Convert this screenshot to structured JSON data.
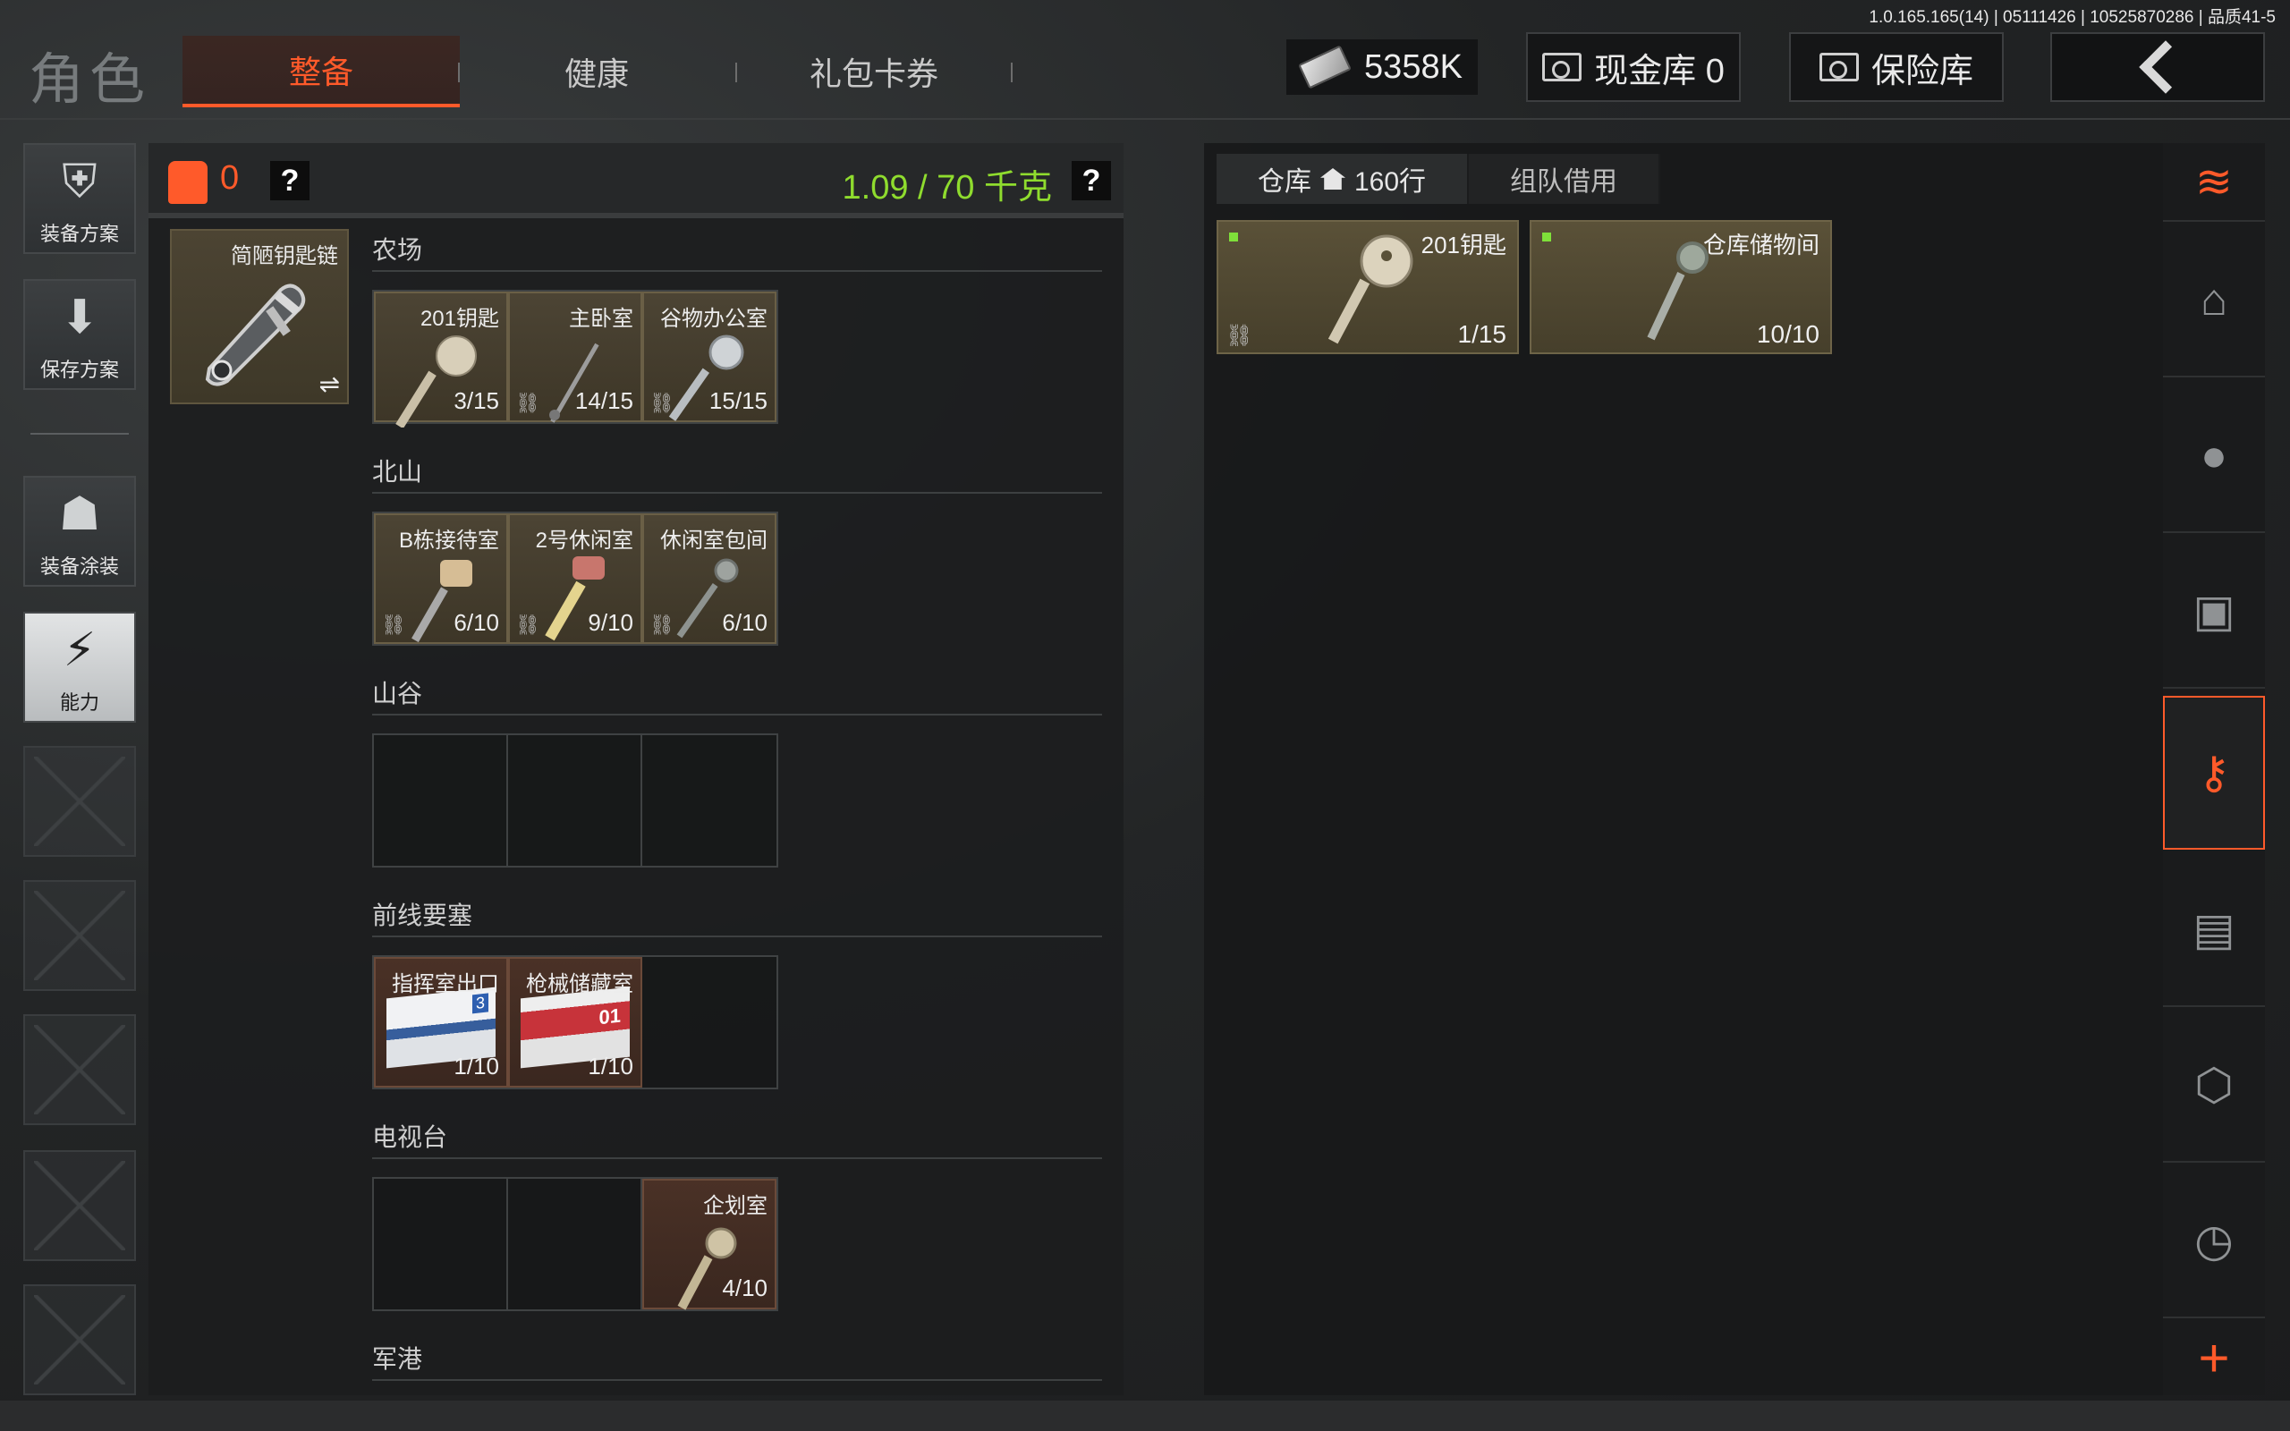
{
  "version_info": "1.0.165.165(14) | 05111426 | 10525870286 | 品质41-5",
  "header": {
    "title": "角色",
    "tabs": [
      {
        "label": "整备",
        "active": true
      },
      {
        "label": "健康",
        "active": false
      },
      {
        "label": "礼包卡券",
        "active": false
      }
    ],
    "currency": "5358K",
    "cash_vault_label": "现金库 0",
    "safe_label": "保险库",
    "back_icon": "chevron-left-icon"
  },
  "sidebar": {
    "items": [
      {
        "label": "装备方案",
        "icon": "armor-icon"
      },
      {
        "label": "保存方案",
        "icon": "download-icon"
      },
      {
        "label": "装备涂装",
        "icon": "helmet-icon"
      },
      {
        "label": "能力",
        "icon": "lightning-icon",
        "active": true
      }
    ],
    "empty_slots": 5
  },
  "keychain": {
    "vest_count": "0",
    "help_label": "?",
    "weight": "1.09 / 70 千克",
    "item_name": "简陋钥匙链",
    "swap_icon": "⇌",
    "sections": [
      {
        "title": "农场",
        "slots": [
          {
            "name": "201钥匙",
            "count": "3/15",
            "type": "key"
          },
          {
            "name": "主卧室",
            "count": "14/15",
            "type": "key"
          },
          {
            "name": "谷物办公室",
            "count": "15/15",
            "type": "key"
          }
        ]
      },
      {
        "title": "北山",
        "slots": [
          {
            "name": "B栋接待室",
            "count": "6/10",
            "type": "key"
          },
          {
            "name": "2号休闲室",
            "count": "9/10",
            "type": "key"
          },
          {
            "name": "休闲室包间",
            "count": "6/10",
            "type": "key"
          }
        ]
      },
      {
        "title": "山谷",
        "slots": []
      },
      {
        "title": "前线要塞",
        "slots": [
          {
            "name": "指挥室出口",
            "count": "1/10",
            "type": "card-blue",
            "card_text": "3"
          },
          {
            "name": "枪械储藏室",
            "count": "1/10",
            "type": "card-red",
            "card_text": "01"
          }
        ]
      },
      {
        "title": "电视台",
        "slots": [
          {
            "name": "企划室",
            "count": "4/10",
            "type": "key",
            "position": 3
          }
        ]
      },
      {
        "title": "军港",
        "slots": []
      }
    ]
  },
  "warehouse": {
    "tabs": [
      {
        "label": "仓库",
        "rows": "160行",
        "active": true
      },
      {
        "label": "组队借用",
        "active": false
      }
    ],
    "items": [
      {
        "name": "201钥匙",
        "count": "1/15"
      },
      {
        "name": "仓库储物间",
        "count": "10/10"
      }
    ]
  },
  "right_rail": {
    "icons": [
      "stack-refresh-icon",
      "home-icon",
      "grenade-icon",
      "ammo-box-icon",
      "key-download-icon",
      "cash-icon",
      "crate-icon",
      "clock-icon",
      "plus-icon"
    ]
  },
  "colors": {
    "accent": "#ff5a2a",
    "weight_green": "#8fdc2e",
    "item_gold": "#4c4434"
  }
}
